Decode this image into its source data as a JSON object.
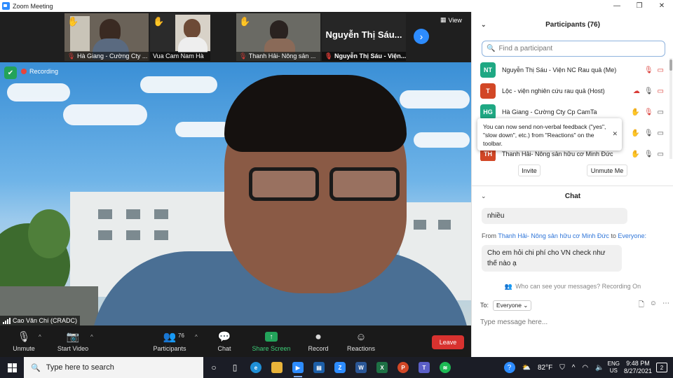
{
  "window": {
    "title": "Zoom Meeting",
    "controls": [
      "—",
      "❐",
      "✕"
    ]
  },
  "thumbnails": [
    {
      "name": "Hà Giang - Cường Cty ...",
      "muted": true
    },
    {
      "name": "Vua Cam Nam Hà",
      "muted": false
    },
    {
      "name": "Thanh Hải- Nông sản ...",
      "muted": true
    },
    {
      "name": "Nguyễn Thị Sáu - Viện...",
      "muted": true,
      "display_text": "Nguyễn Thị Sáu..."
    }
  ],
  "view_label": "View",
  "recording_label": "Recording",
  "speaker_name": "Cao Văn Chí (CRADC)",
  "toolbar": {
    "unmute": "Unmute",
    "start_video": "Start Video",
    "participants": "Participants",
    "participants_count": "76",
    "chat": "Chat",
    "share_screen": "Share Screen",
    "record": "Record",
    "reactions": "Reactions",
    "leave": "Leave"
  },
  "participants_panel": {
    "title": "Participants (76)",
    "search_placeholder": "Find a participant",
    "rows": [
      {
        "initials": "NT",
        "color": "#1fa883",
        "name": "Nguyễn Thị Sáu - Viện NC Rau quả (Me)"
      },
      {
        "initials": "T",
        "color": "#d24726",
        "name": "Lộc - viện nghiên cứu rau quả (Host)"
      },
      {
        "initials": "HG",
        "color": "#1fa883",
        "name": "Hà Giang - Cường Cty Cp CamTa"
      },
      {
        "initials": "",
        "color": "#2d8cff",
        "name": ""
      },
      {
        "initials": "TH",
        "color": "#d24726",
        "name": "Thanh Hải- Nông sản hữu cơ Minh Đức"
      }
    ],
    "tooltip": "You can now send non-verbal feedback (\"yes\", \"slow down\", etc.) from \"Reactions\" on the toolbar.",
    "invite": "Invite",
    "unmute_me": "Unmute Me"
  },
  "chat_panel": {
    "title": "Chat",
    "prev_message": "nhiều",
    "from_prefix": "From",
    "from_sender": "Thanh Hải- Nông sản hữu cơ Minh Đức",
    "from_to": "to",
    "from_recipient": "Everyone:",
    "message": "Cho em hỏi chi phí cho VN check như thế nào ạ",
    "who_can_see": "Who can see your messages? Recording On",
    "to_label": "To:",
    "to_value": "Everyone",
    "input_placeholder": "Type message here..."
  },
  "taskbar": {
    "search_placeholder": "Type here to search",
    "weather": "82°F",
    "lang_top": "ENG",
    "lang_bottom": "US",
    "time": "9:48 PM",
    "date": "8/27/2021",
    "notif_count": "2"
  }
}
